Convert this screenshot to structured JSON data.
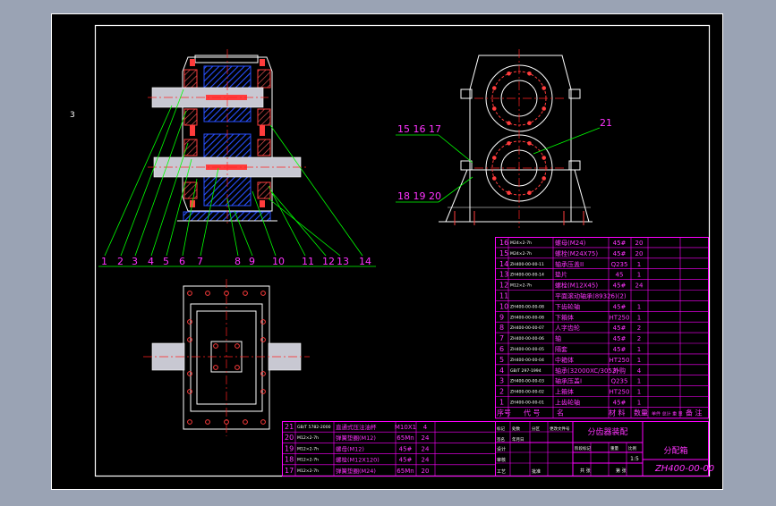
{
  "sheet_marker": "3",
  "front_view_callouts": [
    "1",
    "2",
    "3",
    "4",
    "5",
    "6",
    "7",
    "8",
    "9",
    "10",
    "11",
    "12",
    "13",
    "14"
  ],
  "side_view_callouts": {
    "group_a": "15 16 17",
    "group_b": "18 19 20",
    "single": "21"
  },
  "parts_list_right": [
    {
      "no": "16",
      "code": "M24×2-7h",
      "name": "螺母(M24)",
      "material": "45#",
      "qty": "20"
    },
    {
      "no": "15",
      "code": "M24×2-7h",
      "name": "螺栓(M24X75)",
      "material": "45#",
      "qty": "20"
    },
    {
      "no": "14",
      "code": "ZH400-00-00-11",
      "name": "轴承压盖II",
      "material": "Q235",
      "qty": "1"
    },
    {
      "no": "13",
      "code": "ZH400-00-00-14",
      "name": "垫片",
      "material": "45",
      "qty": "1"
    },
    {
      "no": "12",
      "code": "M12×2-7h",
      "name": "螺栓(M12X45)",
      "material": "45#",
      "qty": "24"
    },
    {
      "no": "11",
      "code": "",
      "name": "平面滚动轴承(89326)(2)",
      "material": "",
      "qty": ""
    },
    {
      "no": "10",
      "code": "ZH400-00-00-08",
      "name": "下齿轮轴",
      "material": "45#",
      "qty": "1"
    },
    {
      "no": "9",
      "code": "ZH400-00-00-08",
      "name": "下箱体",
      "material": "HT250",
      "qty": "1"
    },
    {
      "no": "8",
      "code": "ZH400-00-00-07",
      "name": "人字齿轮",
      "material": "45#",
      "qty": "2"
    },
    {
      "no": "7",
      "code": "ZH400-00-00-06",
      "name": "轴",
      "material": "45#",
      "qty": "2"
    },
    {
      "no": "6",
      "code": "ZH400-00-00-05",
      "name": "隔套",
      "material": "45#",
      "qty": "1"
    },
    {
      "no": "5",
      "code": "ZH400-00-00-04",
      "name": "中箱体",
      "material": "HT250",
      "qty": "1"
    },
    {
      "no": "4",
      "code": "GB/T 297-1994",
      "name": "轴承(32000XC/3052)",
      "material": "外购",
      "qty": "4"
    },
    {
      "no": "3",
      "code": "ZH400-00-00-03",
      "name": "轴承压盖I",
      "material": "Q235",
      "qty": "1"
    },
    {
      "no": "2",
      "code": "ZH400-00-00-02",
      "name": "上箱体",
      "material": "HT250",
      "qty": "1"
    },
    {
      "no": "1",
      "code": "ZH400-00-00-01",
      "name": "上齿轮轴",
      "material": "45#",
      "qty": "1"
    }
  ],
  "parts_list_header": [
    "序号",
    "代 号",
    "名",
    "材 料",
    "数量",
    "单件 总计 重 量",
    "备 注"
  ],
  "parts_list_left": [
    {
      "no": "21",
      "code": "GB/T 5782-2000",
      "name": "直通式压注油杯",
      "material": "M10X1",
      "qty": "4"
    },
    {
      "no": "20",
      "code": "M12×2-7h",
      "name": "弹簧垫圈(M12)",
      "material": "65Mn",
      "qty": "24"
    },
    {
      "no": "19",
      "code": "M12×2-7h",
      "name": "螺母(M12)",
      "material": "45#",
      "qty": "24"
    },
    {
      "no": "18",
      "code": "M12×2-7h",
      "name": "螺栓(M12X120)",
      "material": "45#",
      "qty": "24"
    },
    {
      "no": "17",
      "code": "M12×2-7h",
      "name": "弹簧垫圈(M24)",
      "material": "65Mn",
      "qty": "20"
    }
  ],
  "title_block": {
    "assembly_name": "分齿器装配",
    "part_name": "分配箱",
    "drawing_no": "ZH400-00-00",
    "scale": "1:5",
    "row_labels": [
      "标记",
      "处数",
      "分区",
      "更改文件号",
      "签名",
      "年月日"
    ],
    "role_labels": [
      "设计",
      "审核",
      "工艺",
      "批准"
    ],
    "stage_labels": [
      "阶段标记",
      "重量",
      "比例"
    ],
    "sheet_labels": [
      "共 张",
      "第 张"
    ]
  },
  "colors": {
    "sheet": "#000000",
    "frame": "#ffffff",
    "table": "#ff00ff",
    "leader": "#00ff00",
    "center_line": "#ff2020",
    "shaft": "#c8c8d2",
    "hatch": "#2850ff",
    "bolt": "#ff3c3c",
    "outline": "#ffffff",
    "marker": "#ffffff"
  }
}
